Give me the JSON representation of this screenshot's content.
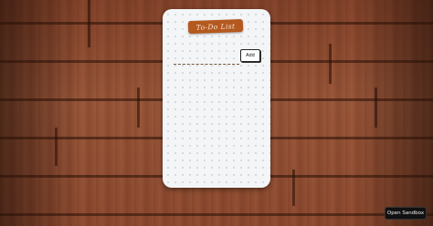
{
  "todo_card": {
    "title": "To-Do List",
    "task_input": {
      "value": "",
      "placeholder": ""
    },
    "add_label": "Add"
  },
  "sandbox": {
    "open_label": "Open Sandbox"
  },
  "colors": {
    "title_tag": "#b4591f",
    "card": "#f3f5f7",
    "wood": "#8a4a30",
    "sandbox_button": "#111111"
  }
}
